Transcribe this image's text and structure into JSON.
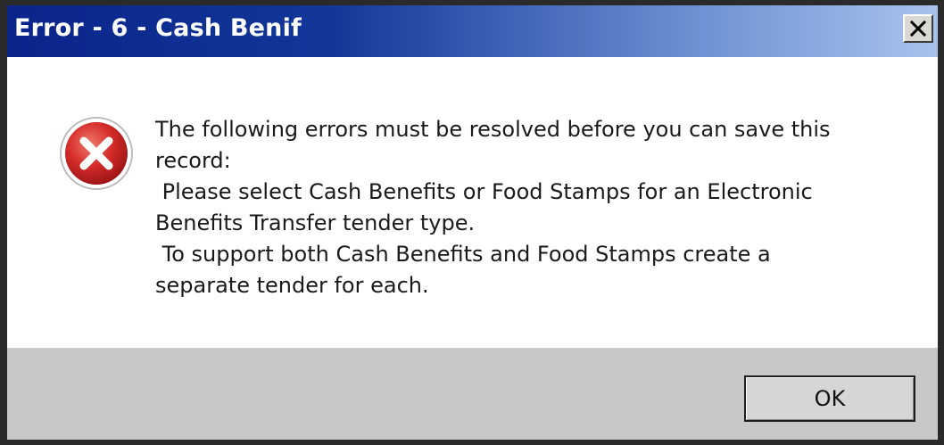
{
  "window": {
    "title": "Error - 6 - Cash Benif",
    "close_icon": "close-icon"
  },
  "content": {
    "icon": "error-icon",
    "message": "The following errors must be resolved before you can save this\nrecord:\n Please select Cash Benefits or Food Stamps for an Electronic\nBenefits Transfer tender type.\n To support both Cash Benefits and Food Stamps create a\nseparate tender for each."
  },
  "footer": {
    "ok_label": "OK"
  },
  "colors": {
    "titlebar_start": "#0a248a",
    "titlebar_end": "#a8c3ec",
    "footer_bg": "#c9c8c8",
    "error_red": "#d0262b"
  }
}
